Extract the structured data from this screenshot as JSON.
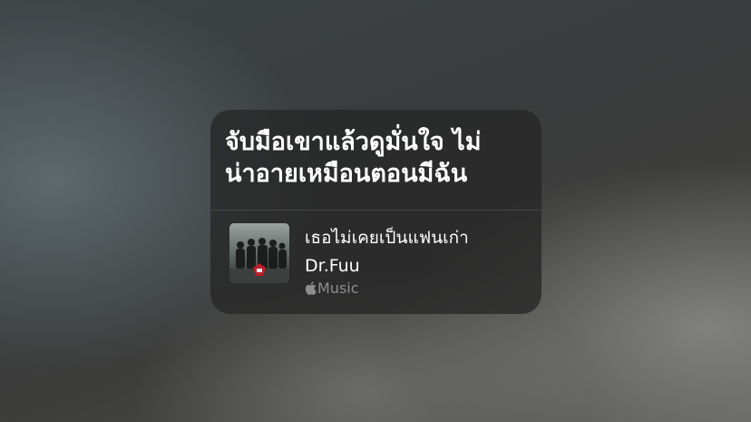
{
  "lyric": {
    "lines": [
      "จับมือเขาแล้วดูมั่นใจ ไม่",
      "น่าอายเหมือนตอนมีฉัน"
    ]
  },
  "track": {
    "title": "เธอไม่เคยเป็นแฟนเก่า",
    "artist": "Dr.Fuu",
    "service": "Music",
    "service_icon": "apple-logo-icon",
    "album_art_icon": "album-art-band-photo"
  },
  "colors": {
    "card_background": "#262626",
    "primary_text": "#ffffff",
    "secondary_text": "#8e8e8e"
  }
}
